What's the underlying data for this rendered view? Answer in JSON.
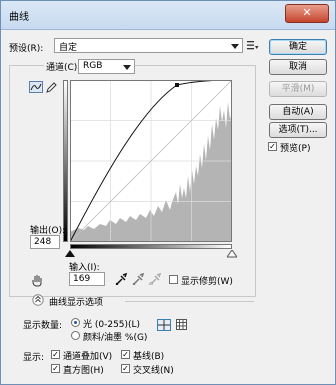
{
  "window": {
    "title": "曲线",
    "close_glyph": "✕"
  },
  "preset": {
    "label": "预设(R):",
    "value": "自定",
    "menu_icon": "list-menu-icon"
  },
  "channel": {
    "label": "通道(C):",
    "value": "RGB"
  },
  "buttons": {
    "ok": "确定",
    "cancel": "取消",
    "smooth": "平滑(M)",
    "auto": "自动(A)",
    "options": "选项(T)..."
  },
  "preview": {
    "label": "预览(P)",
    "checked": true
  },
  "output": {
    "label": "输出(O):",
    "value": "248"
  },
  "input": {
    "label": "输入(I):",
    "value": "169"
  },
  "show_clipping": {
    "label": "显示修剪(W)",
    "checked": false
  },
  "display_options_label": "曲线显示选项",
  "show_amount": {
    "label": "显示数量:",
    "options": [
      "光 (0-255)(L)",
      "颜料/油墨 %(G)"
    ],
    "selected": 0
  },
  "show": {
    "label": "显示:",
    "items": [
      {
        "label": "通道叠加(V)",
        "checked": true
      },
      {
        "label": "基线(B)",
        "checked": true
      },
      {
        "label": "直方图(H)",
        "checked": true
      },
      {
        "label": "交叉线(N)",
        "checked": true
      }
    ]
  },
  "colors": {
    "accent": "#3c7fb1",
    "histogram": "#b4b4b4"
  }
}
